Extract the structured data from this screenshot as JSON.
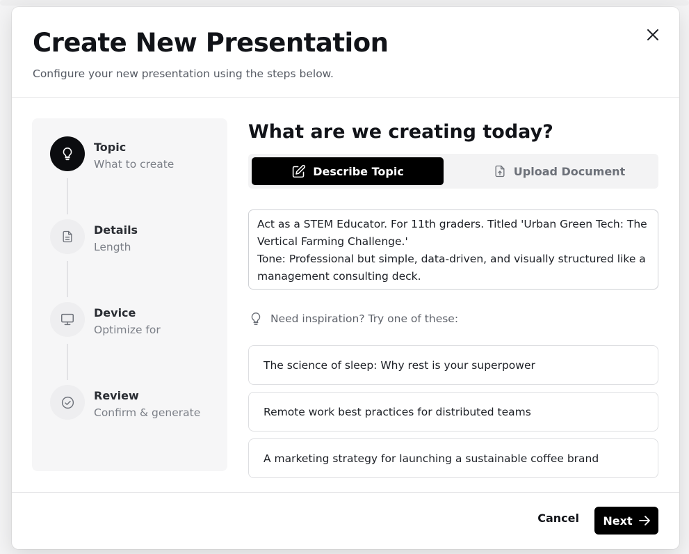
{
  "modal": {
    "title": "Create New Presentation",
    "subtitle": "Configure your new presentation using the steps below.",
    "close_icon": "close-icon"
  },
  "steps": [
    {
      "title": "Topic",
      "description": "What to create",
      "icon": "lightbulb-icon",
      "active": true
    },
    {
      "title": "Details",
      "description": "Length",
      "icon": "document-icon",
      "active": false
    },
    {
      "title": "Device",
      "description": "Optimize for",
      "icon": "monitor-icon",
      "active": false
    },
    {
      "title": "Review",
      "description": "Confirm & generate",
      "icon": "check-circle-icon",
      "active": false
    }
  ],
  "content": {
    "question": "What are we creating today?",
    "tabs": [
      {
        "label": "Describe Topic",
        "icon": "pencil-square-icon",
        "active": true
      },
      {
        "label": "Upload Document",
        "icon": "file-upload-icon",
        "active": false
      }
    ],
    "prompt": "Act as a STEM Educator. For 11th graders. Titled 'Urban Green Tech: The Vertical Farming Challenge.'\nTone: Professional but simple, data-driven, and visually structured like a management consulting deck.",
    "inspiration_label": "Need inspiration? Try one of these:",
    "suggestions": [
      "The science of sleep: Why rest is your superpower",
      "Remote work best practices for distributed teams",
      "A marketing strategy for launching a sustainable coffee brand"
    ]
  },
  "footer": {
    "cancel_label": "Cancel",
    "next_label": "Next"
  },
  "colors": {
    "accent": "#000000",
    "surface": "#ffffff",
    "muted_text": "#7b7f87"
  }
}
